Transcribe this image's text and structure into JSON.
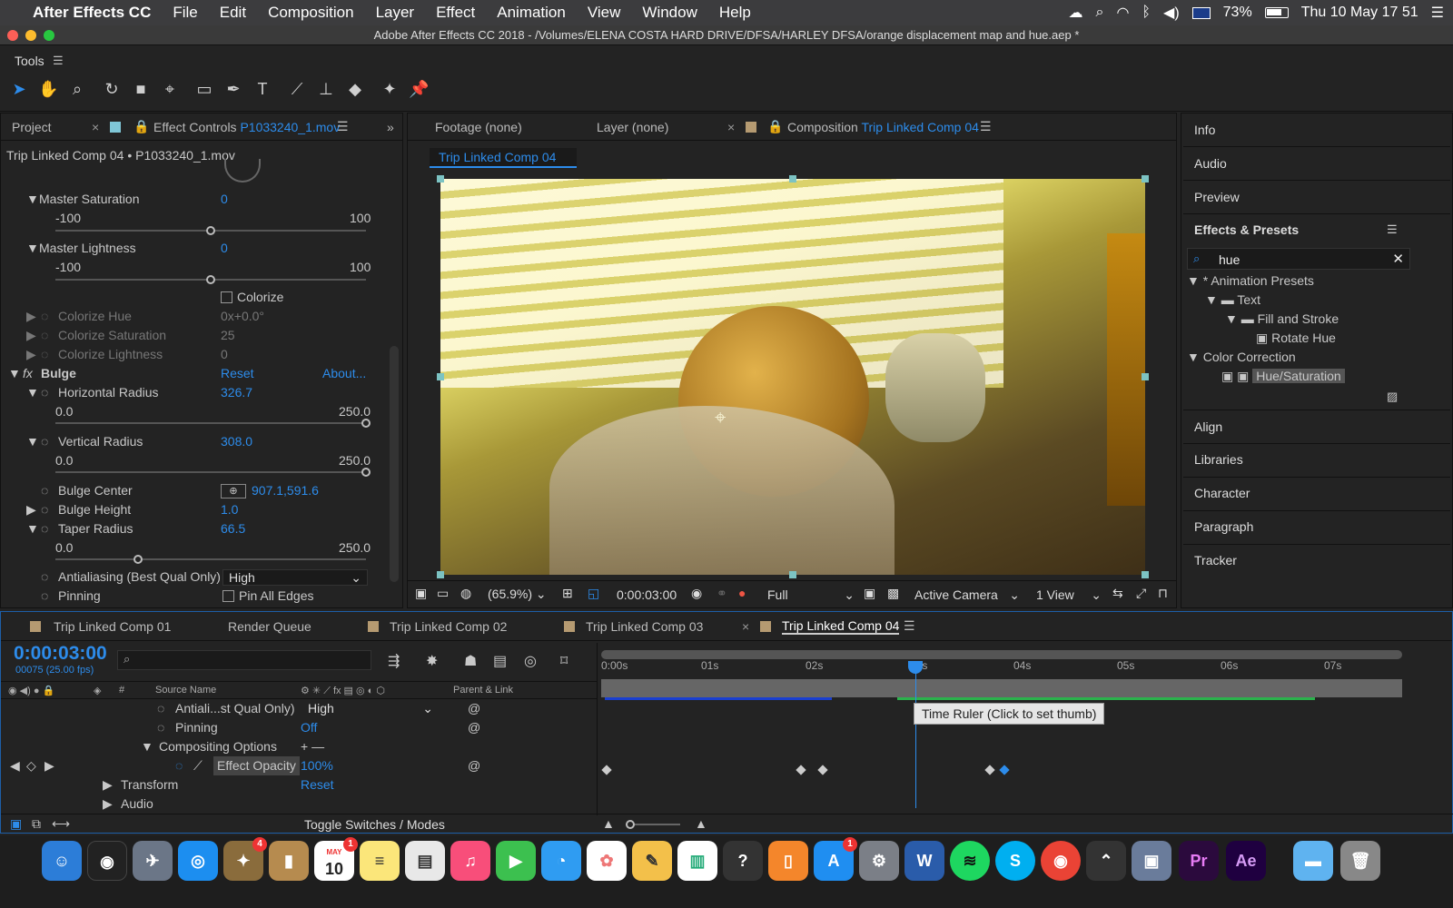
{
  "menubar": {
    "app": "After Effects CC",
    "items": [
      "File",
      "Edit",
      "Composition",
      "Layer",
      "Effect",
      "Animation",
      "View",
      "Window",
      "Help"
    ],
    "battery": "73%",
    "clock": "Thu 10 May  17 51"
  },
  "window": {
    "title": "Adobe After Effects CC 2018 - /Volumes/ELENA COSTA HARD DRIVE/DFSA/HARLEY DFSA/orange displacement map and hue.aep *"
  },
  "tools": {
    "label": "Tools",
    "icons": [
      "selection-tool-icon",
      "hand-tool-icon",
      "zoom-tool-icon",
      "rotate-tool-icon",
      "camera-tool-icon",
      "pan-behind-icon",
      "rectangle-tool-icon",
      "pen-tool-icon",
      "type-tool-icon",
      "brush-tool-icon",
      "clone-stamp-icon",
      "eraser-icon",
      "roto-brush-icon",
      "puppet-pin-icon"
    ]
  },
  "left_panel": {
    "tab_project": "Project",
    "tab_effect_controls": "Effect Controls",
    "effect_file": "P1033240_1.mov",
    "breadcrumb": "Trip Linked Comp 04 • P1033240_1.mov",
    "master_saturation": {
      "label": "Master Saturation",
      "value": "0",
      "min": "-100",
      "max": "100",
      "level": 0.5
    },
    "master_lightness": {
      "label": "Master Lightness",
      "value": "0",
      "min": "-100",
      "max": "100",
      "level": 0.5
    },
    "colorize": "Colorize",
    "colorize_hue": {
      "label": "Colorize Hue",
      "value": "0x+0.0°"
    },
    "colorize_saturation": {
      "label": "Colorize Saturation",
      "value": "25"
    },
    "colorize_lightness": {
      "label": "Colorize Lightness",
      "value": "0"
    },
    "bulge": {
      "label": "Bulge",
      "reset": "Reset",
      "about": "About..."
    },
    "horizontal_radius": {
      "label": "Horizontal Radius",
      "value": "326.7",
      "min": "0.0",
      "max": "250.0",
      "level": 1.0
    },
    "vertical_radius": {
      "label": "Vertical Radius",
      "value": "308.0",
      "min": "0.0",
      "max": "250.0",
      "level": 1.0
    },
    "bulge_center": {
      "label": "Bulge Center",
      "value": "907.1,591.6"
    },
    "bulge_height": {
      "label": "Bulge Height",
      "value": "1.0"
    },
    "taper_radius": {
      "label": "Taper Radius",
      "value": "66.5",
      "min": "0.0",
      "max": "250.0",
      "level": 0.266
    },
    "antialiasing": {
      "label": "Antialiasing (Best Qual Only)",
      "value": "High"
    },
    "pinning": {
      "label": "Pinning",
      "checkbox": "Pin All Edges"
    }
  },
  "comp_panel": {
    "tab_footage": "Footage (none)",
    "tab_layer": "Layer (none)",
    "tab_comp_prefix": "Composition",
    "tab_comp_name": "Trip Linked Comp 04",
    "sub_tab": "Trip Linked Comp 04",
    "zoom": "(65.9%)",
    "timecode": "0:00:03:00",
    "resolution": "Full",
    "camera": "Active Camera",
    "views": "1 View"
  },
  "right_panel": {
    "info": "Info",
    "audio": "Audio",
    "preview": "Preview",
    "effects_presets": "Effects & Presets",
    "search": "hue",
    "tree": [
      {
        "label": "* Animation Presets",
        "indent": 0
      },
      {
        "label": "Text",
        "indent": 1
      },
      {
        "label": "Fill and Stroke",
        "indent": 2
      },
      {
        "label": "Rotate Hue",
        "indent": 3
      },
      {
        "label": "Color Correction",
        "indent": 0
      },
      {
        "label": "Hue/Saturation",
        "indent": 2
      }
    ],
    "align": "Align",
    "libraries": "Libraries",
    "character": "Character",
    "paragraph": "Paragraph",
    "tracker": "Tracker"
  },
  "timeline": {
    "tabs": [
      "Trip Linked Comp 01",
      "Render Queue",
      "Trip Linked Comp 02",
      "Trip Linked Comp 03",
      "Trip Linked Comp 04"
    ],
    "timecode": "0:00:03:00",
    "frames": "00075 (25.00 fps)",
    "col_source": "Source Name",
    "col_parent": "Parent & Link",
    "rows": [
      {
        "name": "Antiali...st Qual Only)",
        "value": "High"
      },
      {
        "name": "Pinning",
        "value": "Off"
      },
      {
        "name": "Compositing Options",
        "value": "+ —"
      },
      {
        "name": "Effect Opacity",
        "value": "100%"
      },
      {
        "name": "Transform",
        "value": "Reset"
      },
      {
        "name": "Audio",
        "value": ""
      }
    ],
    "ruler": [
      "0:00s",
      "01s",
      "02s",
      "03s",
      "04s",
      "05s",
      "06s",
      "07s"
    ],
    "tooltip": "Time Ruler (Click to set thumb)",
    "toggle": "Toggle Switches / Modes"
  },
  "dock": {
    "badges": {
      "photos": "4",
      "calendar": "1",
      "appstore": "1"
    },
    "calendar_day": "10",
    "calendar_month": "MAY",
    "premiere": "Pr",
    "aftereffects": "Ae"
  }
}
